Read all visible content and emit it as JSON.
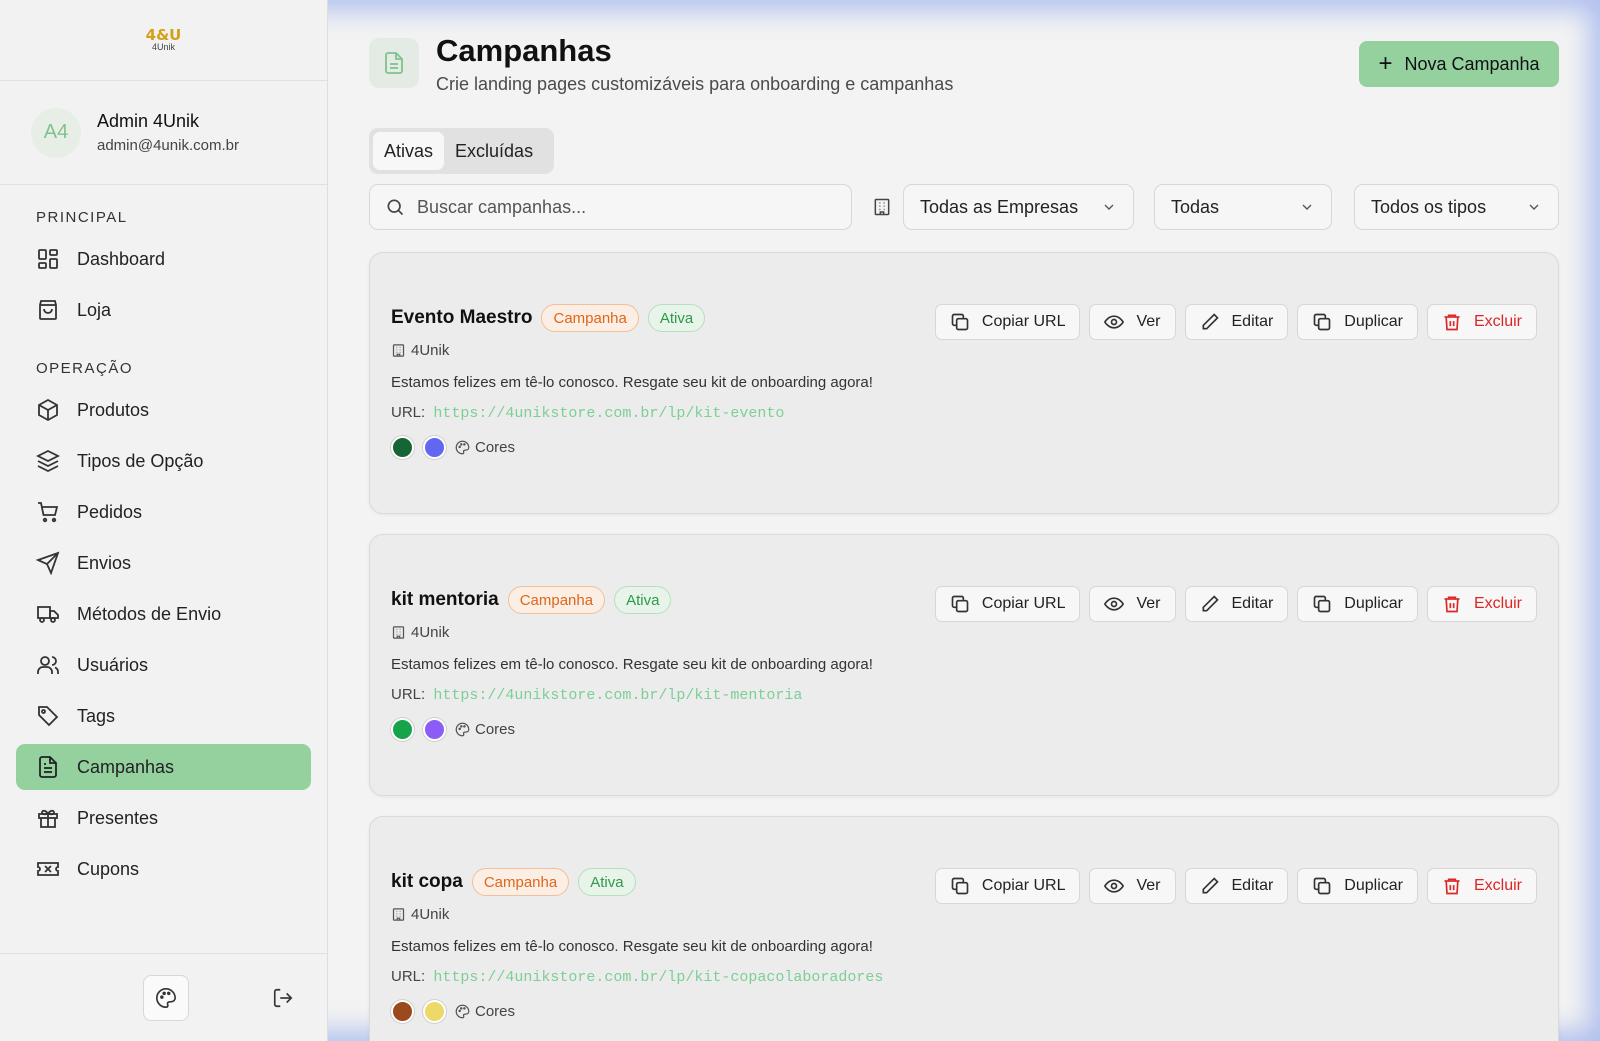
{
  "brand": {
    "logo_mark": "4&U",
    "logo_text": "4Unik"
  },
  "user": {
    "initials": "A4",
    "name": "Admin 4Unik",
    "email": "admin@4unik.com.br"
  },
  "sidebar": {
    "sections": [
      {
        "title": "PRINCIPAL",
        "items": [
          {
            "label": "Dashboard",
            "icon": "dashboard-icon"
          },
          {
            "label": "Loja",
            "icon": "shopping-bag-icon"
          }
        ]
      },
      {
        "title": "OPERAÇÃO",
        "items": [
          {
            "label": "Produtos",
            "icon": "box-icon"
          },
          {
            "label": "Tipos de Opção",
            "icon": "layers-icon"
          },
          {
            "label": "Pedidos",
            "icon": "cart-icon"
          },
          {
            "label": "Envios",
            "icon": "send-icon"
          },
          {
            "label": "Métodos de Envio",
            "icon": "truck-icon"
          },
          {
            "label": "Usuários",
            "icon": "users-icon"
          },
          {
            "label": "Tags",
            "icon": "tag-icon"
          },
          {
            "label": "Campanhas",
            "icon": "file-text-icon",
            "active": true
          },
          {
            "label": "Presentes",
            "icon": "gift-icon"
          },
          {
            "label": "Cupons",
            "icon": "ticket-icon"
          }
        ]
      }
    ]
  },
  "header": {
    "title": "Campanhas",
    "subtitle": "Crie landing pages customizáveis para onboarding e campanhas",
    "new_button": "Nova Campanha"
  },
  "tabs": [
    "Ativas",
    "Excluídas"
  ],
  "filters": {
    "search_placeholder": "Buscar campanhas...",
    "company": "Todas as Empresas",
    "status": "Todas",
    "type": "Todos os tipos"
  },
  "actions": {
    "copy": "Copiar URL",
    "view": "Ver",
    "edit": "Editar",
    "duplicate": "Duplicar",
    "delete": "Excluir"
  },
  "url_label": "URL:",
  "colors_label": "Cores",
  "campaigns": [
    {
      "name": "Evento Maestro",
      "type": "Campanha",
      "status": "Ativa",
      "company": "4Unik",
      "description": "Estamos felizes em tê-lo conosco. Resgate seu kit de onboarding agora!",
      "url": "https://4unikstore.com.br/lp/kit-evento",
      "colors": [
        "#166534",
        "#6366f1"
      ]
    },
    {
      "name": "kit mentoria",
      "type": "Campanha",
      "status": "Ativa",
      "company": "4Unik",
      "description": "Estamos felizes em tê-lo conosco. Resgate seu kit de onboarding agora!",
      "url": "https://4unikstore.com.br/lp/kit-mentoria",
      "colors": [
        "#16a34a",
        "#8b5cf6"
      ]
    },
    {
      "name": "kit copa",
      "type": "Campanha",
      "status": "Ativa",
      "company": "4Unik",
      "description": "Estamos felizes em tê-lo conosco. Resgate seu kit de onboarding agora!",
      "url": "https://4unikstore.com.br/lp/kit-copacolaboradores",
      "colors": [
        "#9a4a1c",
        "#ecd96a"
      ]
    }
  ]
}
